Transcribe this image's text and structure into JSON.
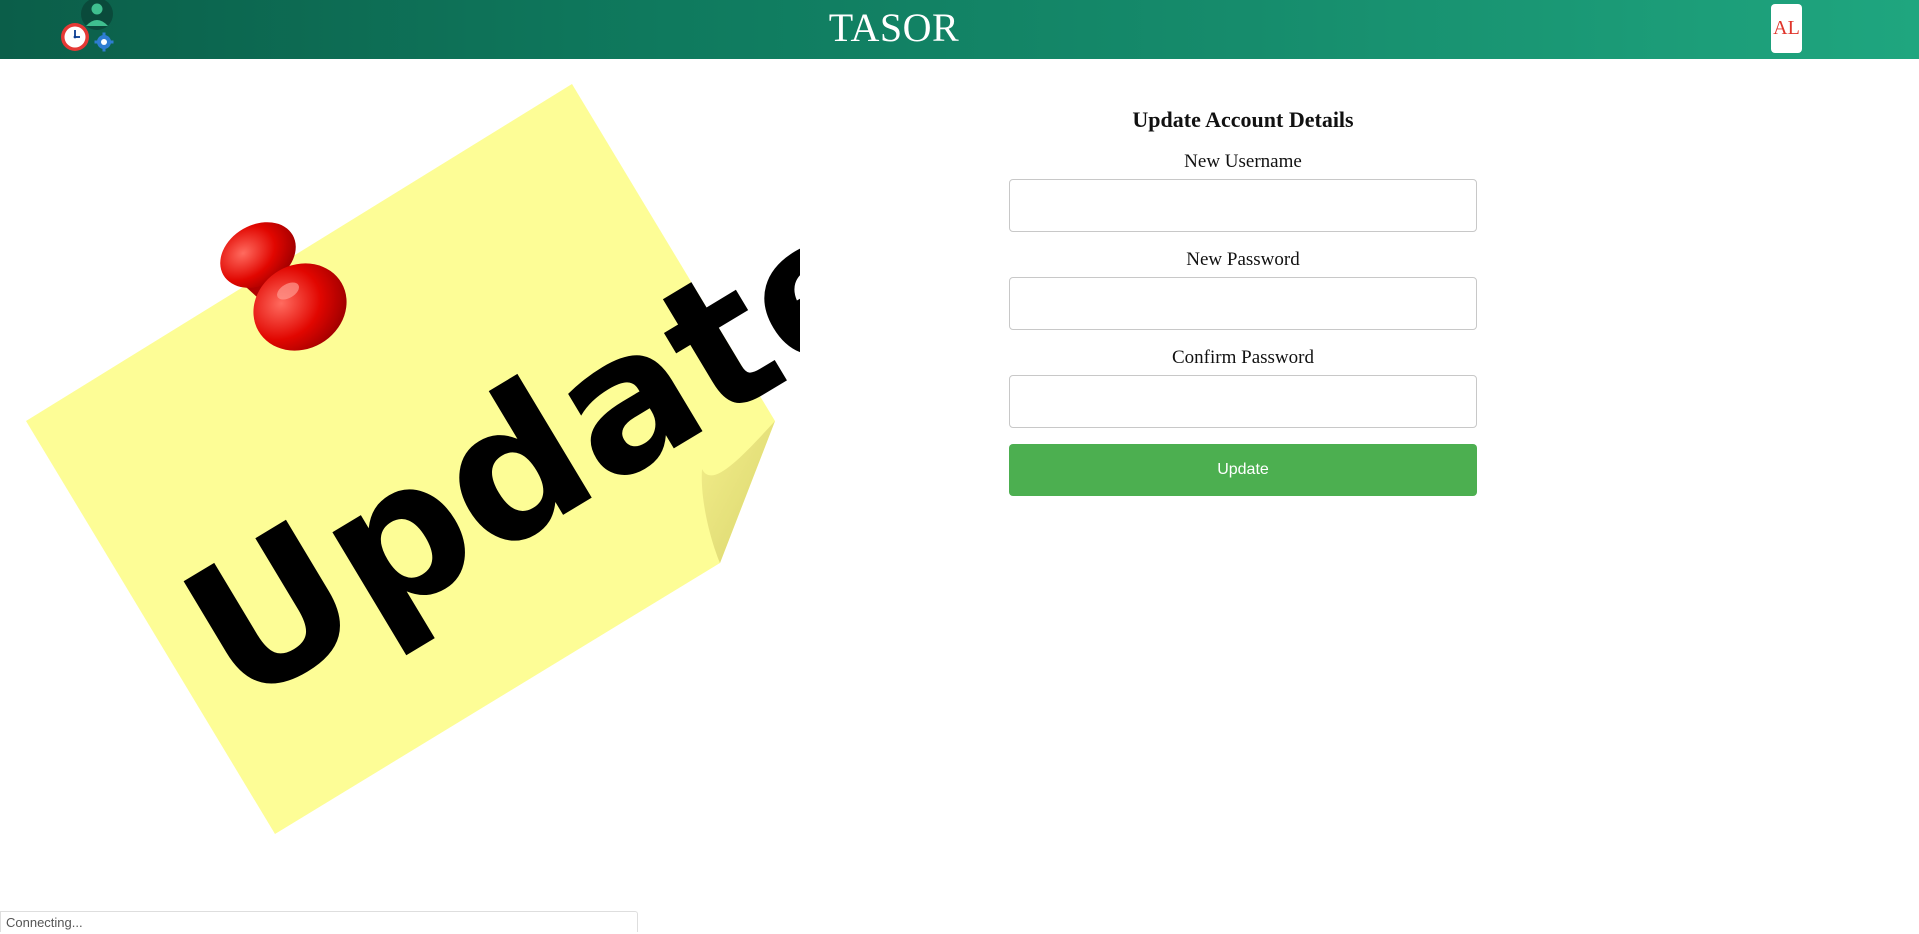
{
  "header": {
    "app_title": "TASOR",
    "avatar_initials": "AL",
    "logo_icon": "user-clock-gear-icon"
  },
  "illustration": {
    "text": "Update",
    "icon": "sticky-note-pushpin-icon"
  },
  "form": {
    "title": "Update Account Details",
    "username": {
      "label": "New Username",
      "value": ""
    },
    "password": {
      "label": "New Password",
      "value": ""
    },
    "confirm_password": {
      "label": "Confirm Password",
      "value": ""
    },
    "submit_label": "Update"
  },
  "status_bar": {
    "text": "Connecting..."
  },
  "colors": {
    "header_start": "#0b5e49",
    "header_end": "#1fa67f",
    "button": "#4caf50",
    "avatar_text": "#e0352b",
    "note": "#fdfd96"
  }
}
